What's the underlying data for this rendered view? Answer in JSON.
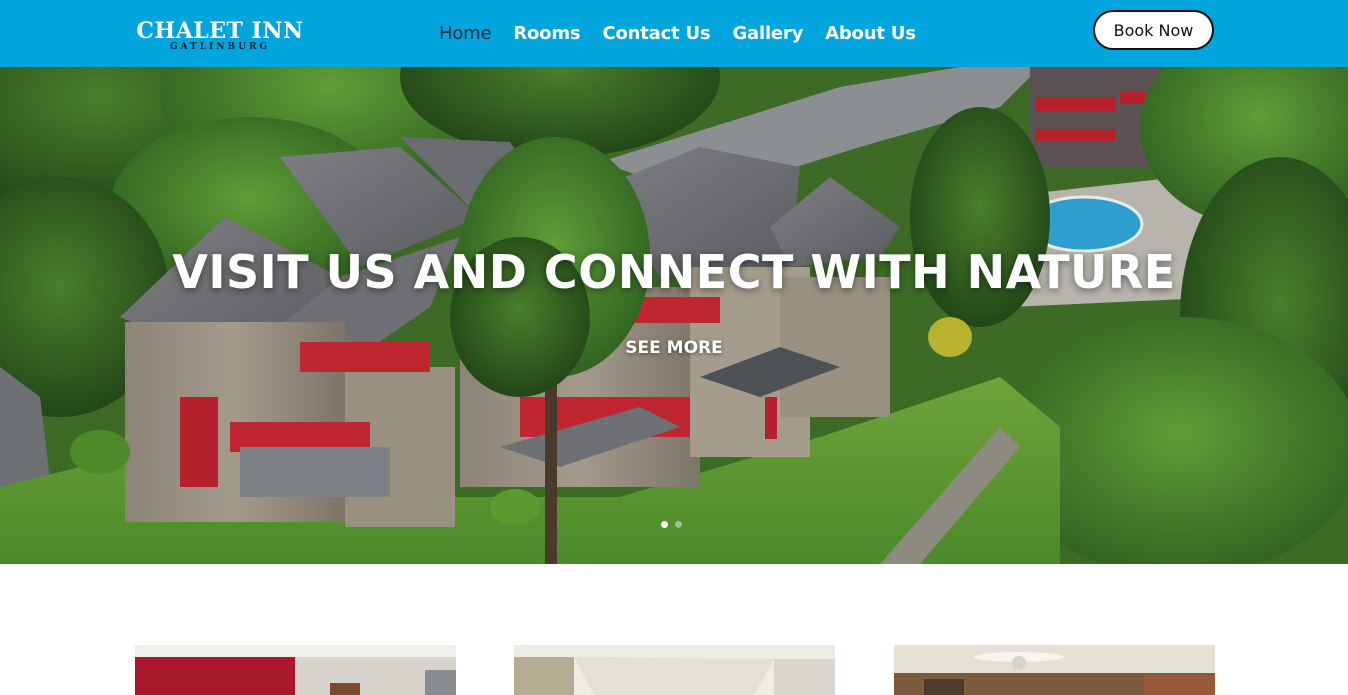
{
  "brand": {
    "name": "Chalet Inn",
    "location": "Gatlinburg"
  },
  "nav": {
    "items": [
      {
        "label": "Home",
        "active": true
      },
      {
        "label": "Rooms"
      },
      {
        "label": "Contact Us"
      },
      {
        "label": "Gallery"
      },
      {
        "label": "About Us"
      }
    ]
  },
  "header": {
    "book_label": "Book Now"
  },
  "hero": {
    "title": "VISIT US AND CONNECT WITH NATURE",
    "cta_label": "SEE MORE",
    "slides_total": 2,
    "active_slide": 1
  },
  "colors": {
    "header_bg": "#00a5de",
    "active_nav": "#1b2a3a",
    "text_light": "#ffffff"
  }
}
